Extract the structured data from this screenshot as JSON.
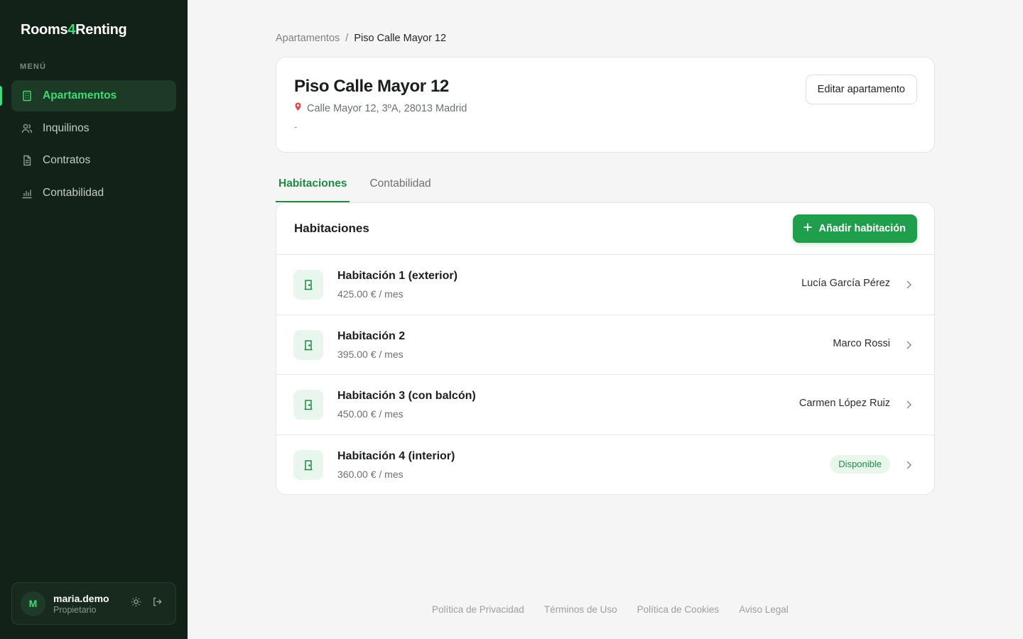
{
  "app": {
    "logo_prefix": "Rooms",
    "logo_accent": "4",
    "logo_suffix": "Renting"
  },
  "sidebar": {
    "menu_label": "MENÚ",
    "items": [
      {
        "label": "Apartamentos",
        "icon": "building-icon",
        "active": true
      },
      {
        "label": "Inquilinos",
        "icon": "users-icon",
        "active": false
      },
      {
        "label": "Contratos",
        "icon": "document-icon",
        "active": false
      },
      {
        "label": "Contabilidad",
        "icon": "bar-chart-icon",
        "active": false
      }
    ],
    "user": {
      "initial": "M",
      "name": "maria.demo",
      "role": "Propietario"
    }
  },
  "breadcrumb": {
    "parent": "Apartamentos",
    "separator": "/",
    "current": "Piso Calle Mayor 12"
  },
  "apartment": {
    "title": "Piso Calle Mayor 12",
    "address": "Calle Mayor 12, 3ºA, 28013 Madrid",
    "description": "-",
    "edit_label": "Editar apartamento"
  },
  "tabs": [
    {
      "label": "Habitaciones",
      "active": true
    },
    {
      "label": "Contabilidad",
      "active": false
    }
  ],
  "rooms": {
    "title": "Habitaciones",
    "add_label": "Añadir habitación",
    "items": [
      {
        "name": "Habitación 1 (exterior)",
        "price": "425.00 € / mes",
        "tenant": "Lucía García Pérez"
      },
      {
        "name": "Habitación 2",
        "price": "395.00 € / mes",
        "tenant": "Marco Rossi"
      },
      {
        "name": "Habitación 3 (con balcón)",
        "price": "450.00 € / mes",
        "tenant": "Carmen López Ruiz"
      },
      {
        "name": "Habitación 4 (interior)",
        "price": "360.00 € / mes",
        "status": "Disponible"
      }
    ]
  },
  "footer": {
    "links": [
      "Política de Privacidad",
      "Términos de Uso",
      "Política de Cookies",
      "Aviso Legal"
    ]
  },
  "colors": {
    "accent": "#3ddc74",
    "primary_green": "#1f9e4b",
    "sidebar_bg": "#132218"
  }
}
